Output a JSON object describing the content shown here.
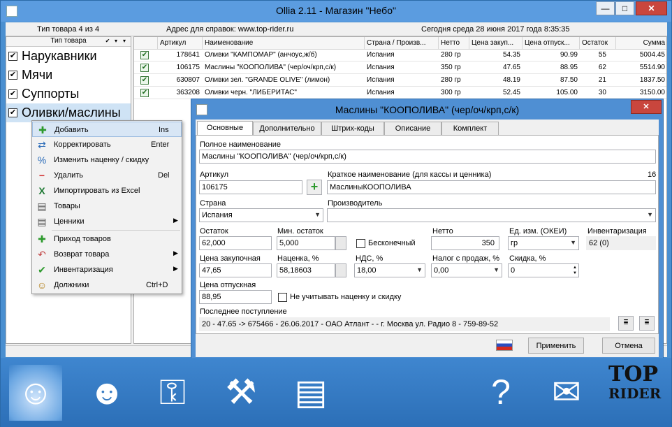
{
  "window": {
    "title": "Ollia 2.11 - Магазин \"Небо\"",
    "min": "—",
    "max": "□",
    "close": "✕"
  },
  "infobar": {
    "type_count": "Тип товара 4 из 4",
    "address": "Адрес для справок: www.top-rider.ru",
    "today": "Сегодня  среда  28 июня 2017 года  8:35:35"
  },
  "left": {
    "header": "Тип товара",
    "categories": [
      "Нарукавники",
      "Мячи",
      "Суппорты",
      "Оливки/маслины"
    ]
  },
  "grid": {
    "headers": [
      "Артикул",
      "Наименование",
      "Страна / Произв...",
      "Нетто",
      "Цена закуп...",
      "Цена отпуск...",
      "Остаток",
      "Сумма"
    ],
    "rows": [
      [
        "178641",
        "Оливки \"КАМПОМАР\" (анчоус,ж/б)",
        "Испания",
        "280 гр",
        "54.35",
        "90.99",
        "55",
        "5004.45"
      ],
      [
        "106175",
        "Маслины \"КООПОЛИВА\" (чер/оч/крп,с/к)",
        "Испания",
        "350 гр",
        "47.65",
        "88.95",
        "62",
        "5514.90"
      ],
      [
        "630807",
        "Оливки зел. \"GRANDE OLIVE\" (лимон)",
        "Испания",
        "280 гр",
        "48.19",
        "87.50",
        "21",
        "1837.50"
      ],
      [
        "363208",
        "Оливки черн. \"ЛИБЕРИТАС\"",
        "Испания",
        "300 гр",
        "52.45",
        "105.00",
        "30",
        "3150.00"
      ]
    ]
  },
  "menu": {
    "items": [
      {
        "label": "Добавить",
        "key": "Ins",
        "icon": "✚"
      },
      {
        "label": "Корректировать",
        "key": "Enter",
        "icon": "⇄"
      },
      {
        "label": "Изменить наценку / скидку",
        "key": "",
        "icon": "%"
      },
      {
        "label": "Удалить",
        "key": "Del",
        "icon": "−"
      },
      {
        "label": "Импортировать из Excel",
        "key": "",
        "icon": "X"
      },
      {
        "label": "Товары",
        "key": "",
        "icon": "▤"
      },
      {
        "label": "Ценники",
        "key": "",
        "icon": "▤"
      },
      {
        "label": "Приход товаров",
        "key": "",
        "icon": "✚"
      },
      {
        "label": "Возврат товара",
        "key": "",
        "icon": "↶"
      },
      {
        "label": "Инвентаризация",
        "key": "",
        "icon": "✔"
      },
      {
        "label": "Должники",
        "key": "Ctrl+D",
        "icon": "☺"
      }
    ],
    "arrow": "▶"
  },
  "dialog": {
    "title": "Маслины \"КООПОЛИВА\" (чер/оч/крп,с/к)",
    "tabs": [
      "Основные",
      "Дополнительно",
      "Штрих-коды",
      "Описание",
      "Комплект"
    ],
    "full_name_label": "Полное наименование",
    "full_name": "Маслины \"КООПОЛИВА\" (чер/оч/крп,с/к)",
    "article_label": "Артикул",
    "article": "106175",
    "short_name_label": "Краткое наименование (для кассы и ценника)",
    "short_name_len": "16",
    "short_name": "МаслиныКООПОЛИВА",
    "country_label": "Страна",
    "country": "Испания",
    "maker_label": "Производитель",
    "maker": "",
    "stock_label": "Остаток",
    "stock": "62,000",
    "min_stock_label": "Мин. остаток",
    "min_stock": "5,000",
    "endless_label": "Бесконечный",
    "netto_label": "Нетто",
    "netto": "350",
    "unit_label": "Ед. изм. (ОКЕИ)",
    "unit": "гр",
    "inventory_label": "Инвентаризация",
    "inventory": "62  (0)",
    "purchase_price_label": "Цена закупочная",
    "purchase_price": "47,65",
    "markup_label": "Наценка, %",
    "markup": "58,18603",
    "vat_label": "НДС, %",
    "vat": "18,00",
    "sales_tax_label": "Налог с продаж, %",
    "sales_tax": "0,00",
    "discount_label": "Скидка, %",
    "discount": "0",
    "sell_price_label": "Цена отпускная",
    "sell_price": "88,95",
    "ignore_markup_label": "Не учитывать наценку и скидку",
    "last_supply_label": "Последнее поступление",
    "last_supply": "20 - 47.65 -> 675466 - 26.06.2017 - ОАО Атлант -  - г. Москва ул. Радио 8 - 759-89-52",
    "apply": "Применить",
    "cancel": "Отмена",
    "plus": "+"
  },
  "toolbar": {
    "icons": [
      "user-icon",
      "users-icon",
      "key-icon",
      "tools-icon",
      "floppy-icon",
      "help-book-icon",
      "mail-sync-icon"
    ],
    "glyphs": [
      "☺",
      "☻",
      "⚿",
      "⚒",
      "▤",
      "?",
      "✉"
    ],
    "logo_top": "TOP",
    "logo_bottom": "RIDER"
  }
}
